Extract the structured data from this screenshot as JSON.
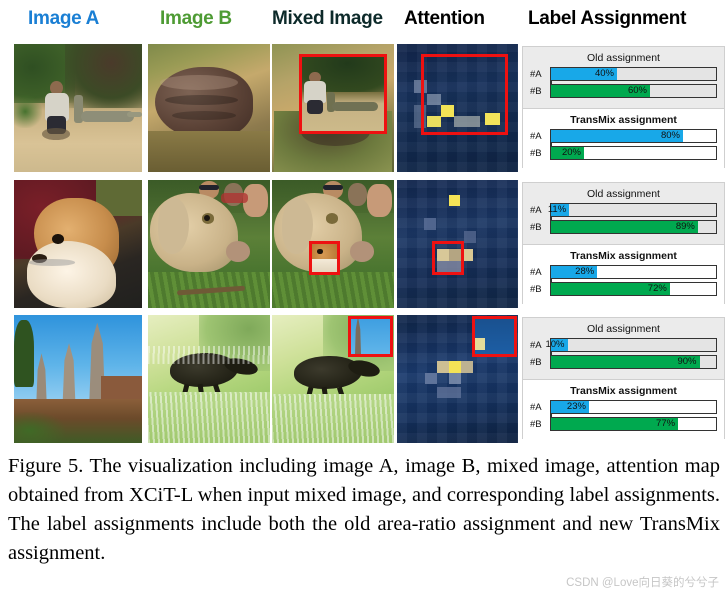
{
  "headers": [
    {
      "id": "image-a",
      "label": "Image A",
      "color": "#1a7fd4"
    },
    {
      "id": "image-b",
      "label": "Image B",
      "color": "#4e9b34"
    },
    {
      "id": "mixed-image",
      "label": "Mixed Image",
      "color": "#0d2a2a"
    },
    {
      "id": "attention",
      "label": "Attention",
      "color": "#000000"
    },
    {
      "id": "label-assignment",
      "label": "Label Assignment",
      "color": "#000000"
    }
  ],
  "panel_titles": {
    "old": "Old  assignment",
    "transmix": "TransMix assignment"
  },
  "series_labels": {
    "a": "#A",
    "b": "#B"
  },
  "colors": {
    "bar_a": "#18a8e8",
    "bar_b": "#00a94f",
    "box": "#ee1111",
    "panel_old_bg": "#ebebeb",
    "panel_transmix_bg": "#ffffff"
  },
  "rows": [
    {
      "id": "row-1",
      "image_a_desc": "man crouching on gravel beside reptile statue",
      "image_b_desc": "close-up of a pill bug / isopod on soil",
      "mixed_desc": "image A patch pasted into center of image B",
      "attention_desc": "attention heatmap with yellow hot spots on pasted patch",
      "old": {
        "a": "40%",
        "b": "60%",
        "a_value": 40,
        "b_value": 60
      },
      "transmix": {
        "a": "80%",
        "b": "20%",
        "a_value": 80,
        "b_value": 20
      }
    },
    {
      "id": "row-2",
      "image_a_desc": "pomeranian dog on a red blanket",
      "image_b_desc": "tan dog lying on grass with people behind",
      "mixed_desc": "small image A patch pasted on the dog's muzzle",
      "attention_desc": "attention heatmap with warm patch at pasted region",
      "old": {
        "a": "11%",
        "b": "89%",
        "a_value": 11,
        "b_value": 89
      },
      "transmix": {
        "a": "28%",
        "b": "72%",
        "a_value": 28,
        "b_value": 72
      }
    },
    {
      "id": "row-3",
      "image_a_desc": "ancient Thai temple spires against blue sky",
      "image_b_desc": "black weevil beetle on a fuzzy green leaf",
      "mixed_desc": "temple patch pasted into top-right corner",
      "attention_desc": "attention heatmap with yellow hot spot on the beetle",
      "old": {
        "a": "10%",
        "b": "90%",
        "a_value": 10,
        "b_value": 90
      },
      "transmix": {
        "a": "23%",
        "b": "77%",
        "a_value": 23,
        "b_value": 77
      }
    }
  ],
  "caption": "Figure 5. The visualization including image A, image B, mixed image, attention map obtained from XCiT-L when input mixed image, and corresponding label assignments. The label assignments include both the old area-ratio assignment and new TransMix assignment.",
  "watermark": "CSDN @Love向日葵的兮兮子",
  "chart_data": {
    "type": "bar",
    "title": "Label Assignment",
    "categories": [
      "#A",
      "#B"
    ],
    "xlabel": "",
    "ylabel": "",
    "xlim": [
      0,
      100
    ],
    "grid": false,
    "legend": "none",
    "panels": [
      {
        "row": 1,
        "name": "Old  assignment",
        "values": [
          40,
          60
        ]
      },
      {
        "row": 1,
        "name": "TransMix assignment",
        "values": [
          80,
          20
        ]
      },
      {
        "row": 2,
        "name": "Old  assignment",
        "values": [
          11,
          89
        ]
      },
      {
        "row": 2,
        "name": "TransMix assignment",
        "values": [
          28,
          72
        ]
      },
      {
        "row": 3,
        "name": "Old  assignment",
        "values": [
          10,
          90
        ]
      },
      {
        "row": 3,
        "name": "TransMix assignment",
        "values": [
          23,
          77
        ]
      }
    ]
  }
}
